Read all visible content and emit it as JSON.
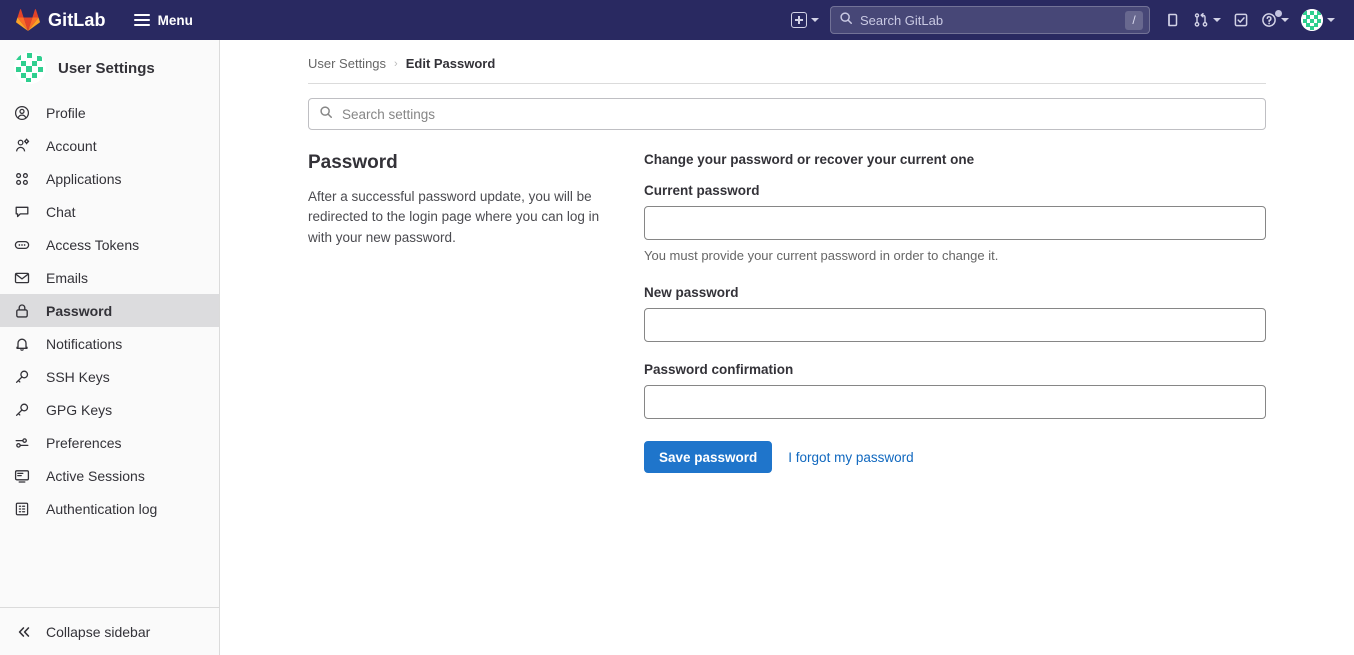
{
  "navbar": {
    "brand_name": "GitLab",
    "brand_logo_icon": "gitlab-tanuki-logo",
    "menu_label": "Menu",
    "hamburger_icon": "hamburger-menu-icon",
    "create_new_icon": "plus-square-icon",
    "create_new_chevron_icon": "chevron-down-icon",
    "search": {
      "placeholder": "Search GitLab",
      "value": "",
      "search_icon": "search-icon",
      "shortcut_key": "/"
    },
    "issues_icon": "issues-icon",
    "merge_requests_icon": "merge-request-icon",
    "merge_requests_chevron_icon": "chevron-down-icon",
    "todos_icon": "todo-check-icon",
    "help_icon": "help-question-circle-icon",
    "help_chevron_icon": "chevron-down-icon",
    "user_avatar_icon": "user-avatar-identicon",
    "user_chevron_icon": "chevron-down-icon"
  },
  "sidebar": {
    "context_title": "User Settings",
    "context_avatar_icon": "user-avatar-identicon",
    "items": [
      {
        "label": "Profile",
        "icon": "profile-user-circle-icon",
        "active": false
      },
      {
        "label": "Account",
        "icon": "account-user-gear-icon",
        "active": false
      },
      {
        "label": "Applications",
        "icon": "applications-grid-icon",
        "active": false
      },
      {
        "label": "Chat",
        "icon": "chat-bubble-icon",
        "active": false
      },
      {
        "label": "Access Tokens",
        "icon": "access-token-icon",
        "active": false
      },
      {
        "label": "Emails",
        "icon": "envelope-icon",
        "active": false
      },
      {
        "label": "Password",
        "icon": "lock-icon",
        "active": true
      },
      {
        "label": "Notifications",
        "icon": "bell-icon",
        "active": false
      },
      {
        "label": "SSH Keys",
        "icon": "key-icon",
        "active": false
      },
      {
        "label": "GPG Keys",
        "icon": "key-icon",
        "active": false
      },
      {
        "label": "Preferences",
        "icon": "preferences-sliders-icon",
        "active": false
      },
      {
        "label": "Active Sessions",
        "icon": "monitor-icon",
        "active": false
      },
      {
        "label": "Authentication log",
        "icon": "log-table-icon",
        "active": false
      }
    ],
    "collapse_label": "Collapse sidebar",
    "collapse_icon": "double-chevron-left-icon"
  },
  "breadcrumb": {
    "root_label": "User Settings",
    "separator": "›",
    "current_label": "Edit Password"
  },
  "search_settings": {
    "placeholder": "Search settings",
    "value": "",
    "icon": "search-icon"
  },
  "section": {
    "title": "Password",
    "description": "After a successful password update, you will be redirected to the login page where you can log in with your new password."
  },
  "form": {
    "legend": "Change your password or recover your current one",
    "current_password": {
      "label": "Current password",
      "value": "",
      "placeholder": "",
      "help": "You must provide your current password in order to change it."
    },
    "new_password": {
      "label": "New password",
      "value": "",
      "placeholder": ""
    },
    "password_confirmation": {
      "label": "Password confirmation",
      "value": "",
      "placeholder": ""
    },
    "submit_label": "Save password",
    "forgot_link_label": "I forgot my password"
  },
  "colors": {
    "navbar_bg": "#292961",
    "sidebar_bg": "#fafafa",
    "sidebar_active_bg": "#dcdcde",
    "primary_button": "#1f75cb",
    "link": "#1068bf",
    "border": "#dbdbdb"
  }
}
